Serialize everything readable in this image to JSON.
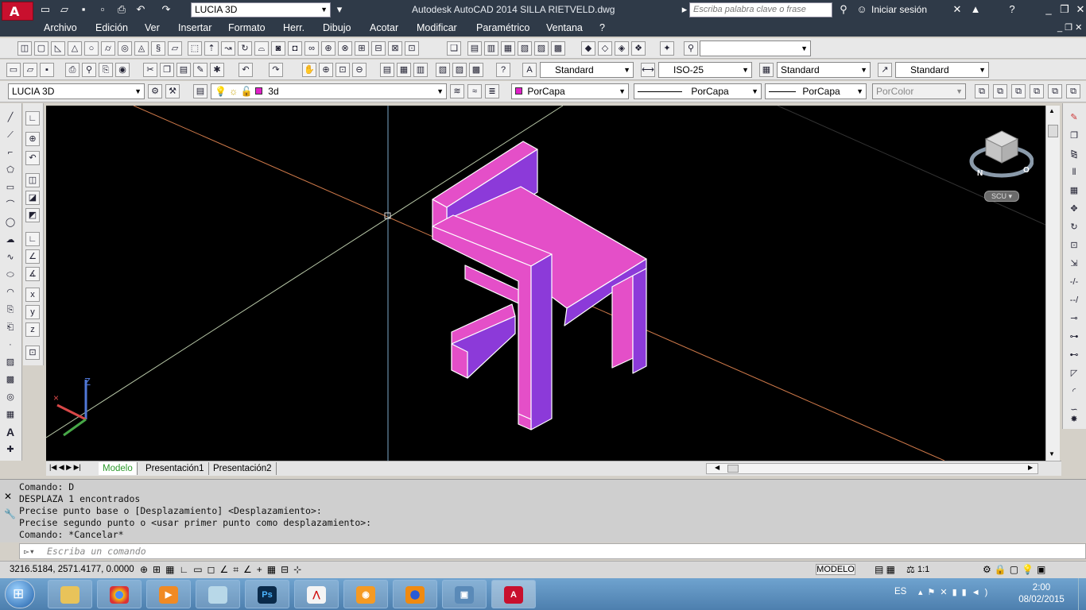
{
  "title_bar": {
    "workspace": "LUCIA 3D",
    "app_title": "Autodesk AutoCAD 2014    SILLA RIETVELD.dwg",
    "search_placeholder": "Escriba palabra clave o frase",
    "signin": "Iniciar sesión"
  },
  "menu": [
    "Archivo",
    "Edición",
    "Ver",
    "Insertar",
    "Formato",
    "Herr.",
    "Dibujo",
    "Acotar",
    "Modificar",
    "Paramétrico",
    "Ventana",
    "?"
  ],
  "styles_toolbar": {
    "text_style": "Standard",
    "dim_style": "ISO-25",
    "table_style": "Standard",
    "mleader_style": "Standard"
  },
  "layers_toolbar": {
    "workspace_combo": "LUCIA 3D",
    "layer": "3d",
    "color": "PorCapa",
    "linetype": "PorCapa",
    "lineweight": "PorCapa",
    "plotstyle": "PorColor"
  },
  "viewcube": {
    "ucs_label": "SCU",
    "compass_n": "N",
    "compass_o": "O"
  },
  "ucs_icon": {
    "z": "Z"
  },
  "layout_tabs": [
    "Modelo",
    "Presentación1",
    "Presentación2"
  ],
  "command_history": [
    "Comando: D",
    "DESPLAZA 1 encontrados",
    "Precise punto base o [Desplazamiento] <Desplazamiento>:",
    "Precise segundo punto o <usar primer punto como desplazamiento>:",
    "Comando: *Cancelar*"
  ],
  "command_placeholder": "Escriba un comando",
  "status_bar": {
    "coordinates": "3216.5184, 2571.4177, 0.0000",
    "space": "MODELO",
    "scale": "1:1"
  },
  "taskbar": {
    "language": "ES",
    "time": "2:00",
    "date": "08/02/2015",
    "apps": [
      "explorer",
      "chrome",
      "media",
      "notes",
      "photoshop",
      "acrobat",
      "blender",
      "firefox",
      "photos",
      "autocad"
    ]
  },
  "colors": {
    "chair_top": "#e44fc8",
    "chair_side": "#8c3ad9",
    "axis_red": "#c8623a",
    "axis_gray": "#c8d4c0"
  }
}
